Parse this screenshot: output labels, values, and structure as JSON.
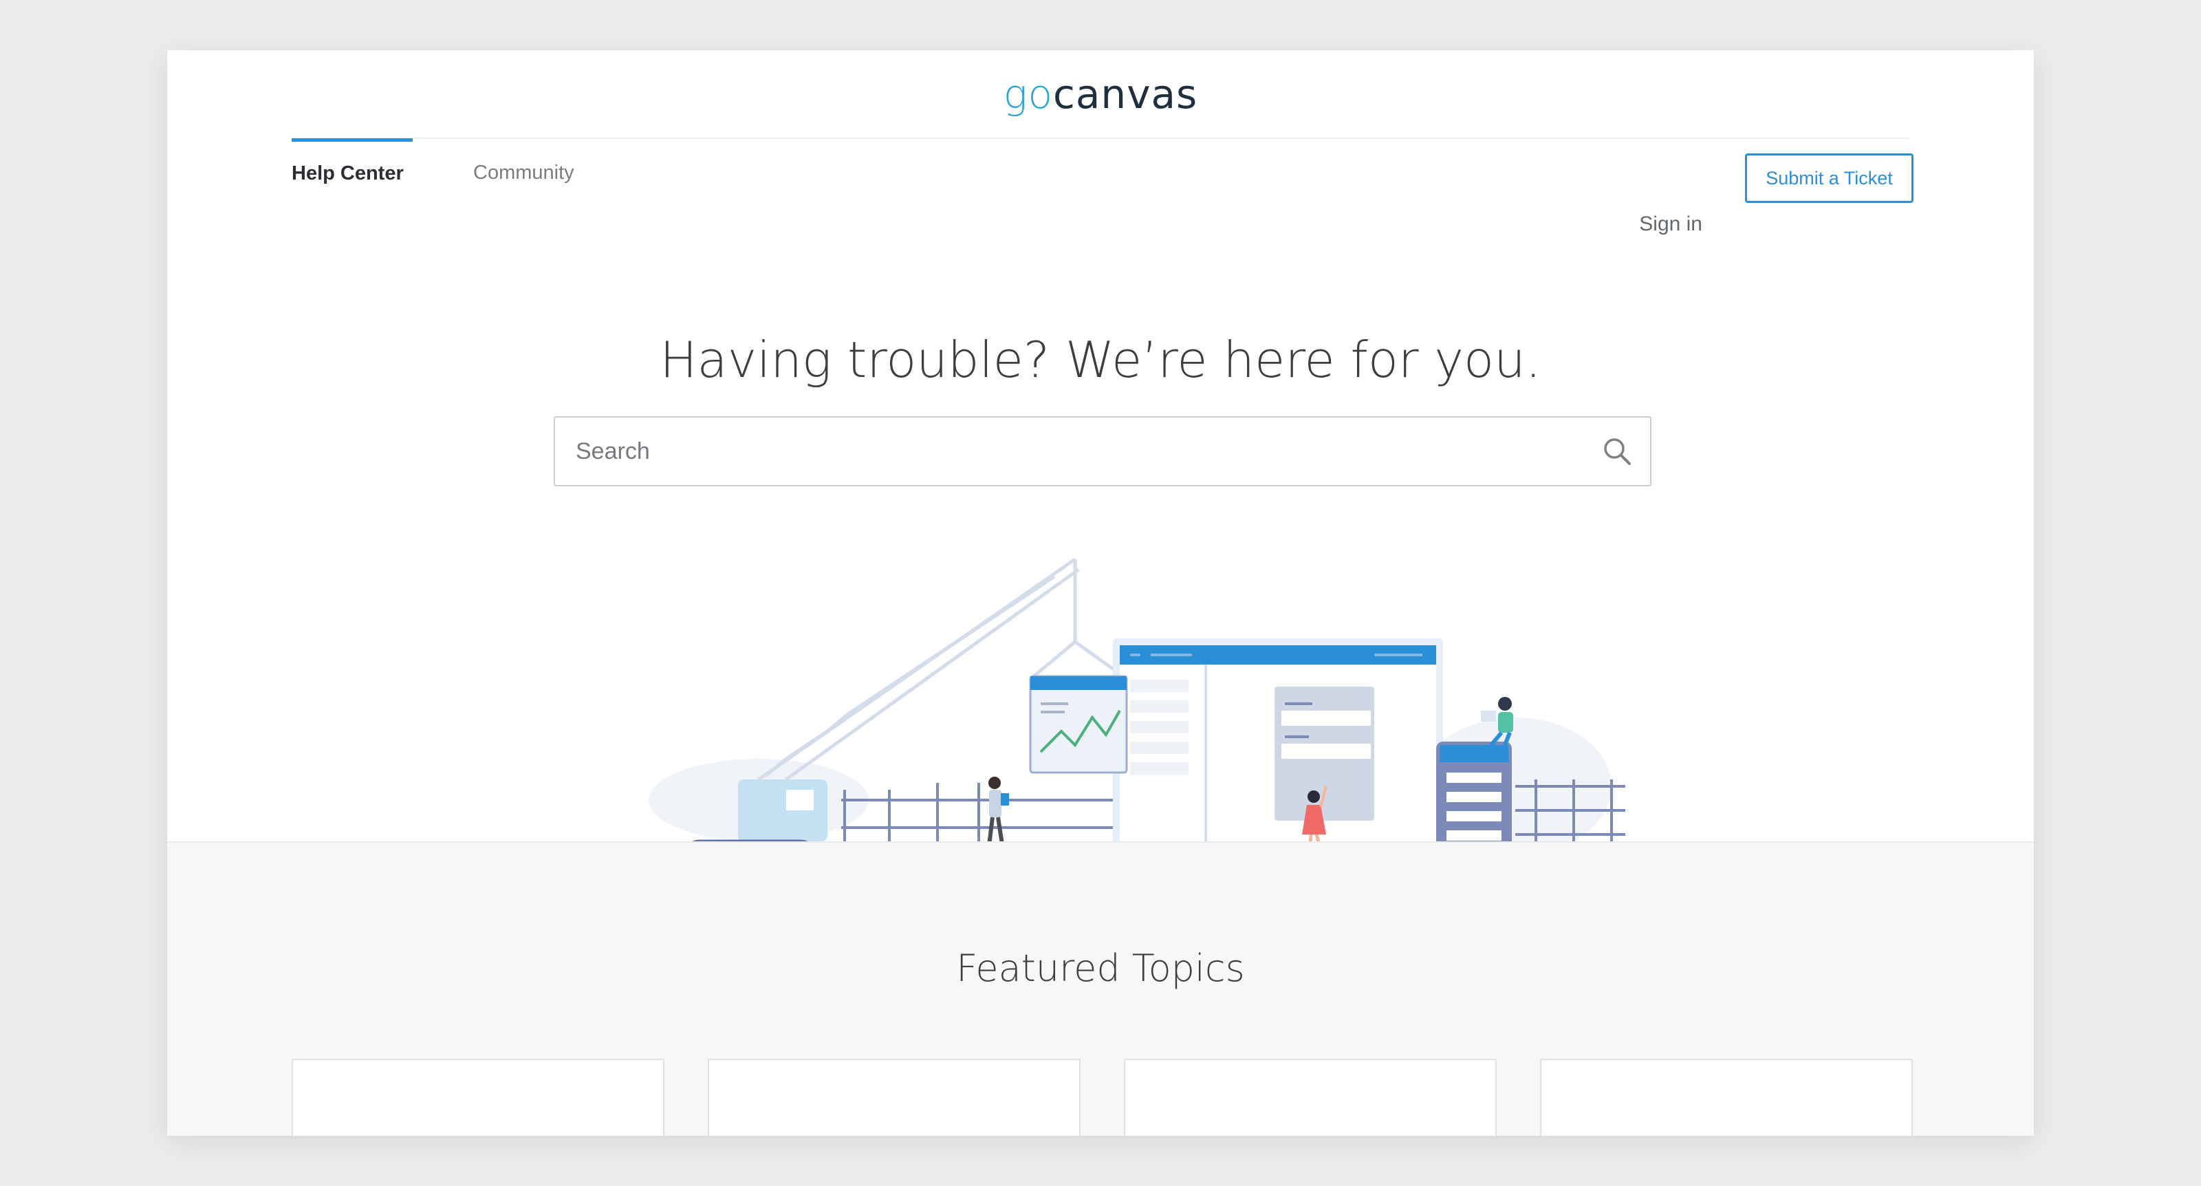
{
  "brand": {
    "logo_go": "go",
    "logo_canvas": "canvas",
    "accent": "#2a8fd6",
    "logo_go_color": "#2aa3d8",
    "logo_canvas_color": "#1f2f3f"
  },
  "nav": {
    "tabs": [
      {
        "label": "Help Center",
        "active": true
      },
      {
        "label": "Community",
        "active": false
      }
    ],
    "sign_in": "Sign in",
    "submit_ticket": "Submit a Ticket"
  },
  "hero": {
    "title": "Having trouble? We’re here for you.",
    "search": {
      "placeholder": "Search",
      "value": "",
      "icon": "search-icon"
    },
    "illustration": "construction-scene-illustration"
  },
  "featured": {
    "title": "Featured Topics",
    "cards": [
      {},
      {},
      {},
      {}
    ]
  }
}
